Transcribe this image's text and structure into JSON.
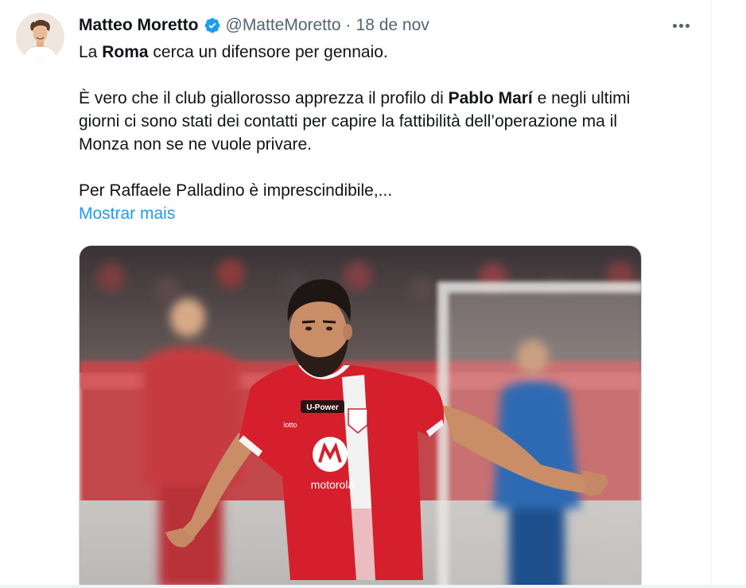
{
  "tweet": {
    "author_name": "Matteo Moretto",
    "handle": "@MatteMoretto",
    "separator": "·",
    "timestamp": "18 de nov",
    "text": {
      "p1_before": "La ",
      "p1_bold": "Roma",
      "p1_after": " cerca un difensore per gennaio.",
      "p2_before": "È vero che il club giallorosso apprezza il profilo di ",
      "p2_bold": "Pablo Marí",
      "p2_line1_after": " e negli ultimi",
      "p2_line2": "giorni ci sono stati dei contatti per capire la fattibilità dell’operazione ma il",
      "p2_line3": "Monza non se ne vuole privare.",
      "p3": "Per Raffaele Palladino è imprescindibile,..."
    },
    "show_more_label": "Mostrar mais",
    "media": {
      "jersey_sponsor_top": "U-Power",
      "jersey_sponsor_main": "motorola",
      "jersey_brand": "lotto"
    }
  },
  "colors": {
    "link": "#1d9bf0",
    "verified": "#1d9bf0",
    "secondary_text": "#536471",
    "primary_text": "#0f1419",
    "jersey_red": "#d61f2c"
  },
  "icons": {
    "verified": "verified-badge-icon",
    "more": "more-options-icon"
  }
}
